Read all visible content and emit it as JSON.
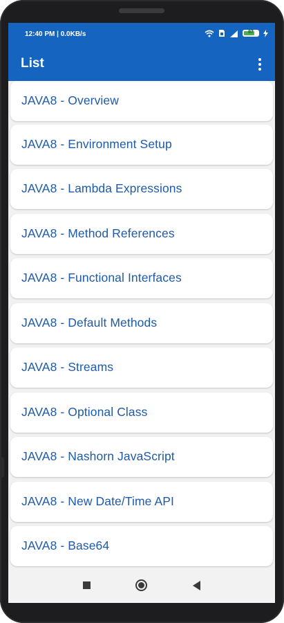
{
  "status": {
    "time_net": "12:40 PM | 0.0KB/s",
    "battery_level": "87",
    "icons": [
      "wifi-icon",
      "sim-icon",
      "signal-icon",
      "battery-icon",
      "charging-icon"
    ]
  },
  "appbar": {
    "title": "List",
    "menu_icon": "more-vert-icon",
    "color": "#1565c0"
  },
  "list": {
    "items": [
      "JAVA8 - Overview",
      "JAVA8 - Environment Setup",
      "JAVA8 - Lambda Expressions",
      "JAVA8 - Method References",
      "JAVA8 - Functional Interfaces",
      "JAVA8 - Default Methods",
      "JAVA8 - Streams",
      "JAVA8 - Optional Class",
      "JAVA8 - Nashorn JavaScript",
      "JAVA8 - New Date/Time API",
      "JAVA8 - Base64"
    ],
    "text_color": "#1e5aa8"
  },
  "navbar": {
    "buttons": [
      "recents-icon",
      "home-icon",
      "back-icon"
    ]
  }
}
